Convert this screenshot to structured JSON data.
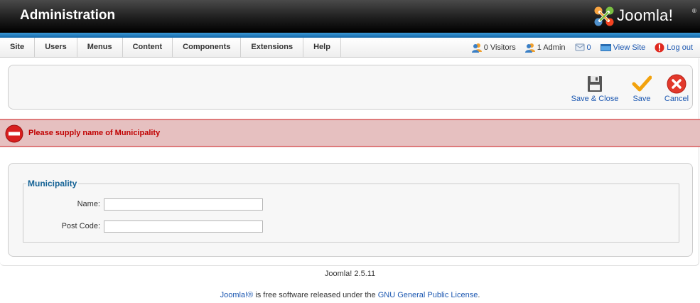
{
  "header": {
    "title": "Administration",
    "logo_text": "Joomla!",
    "logo_reg": "®"
  },
  "menu": {
    "items": [
      "Site",
      "Users",
      "Menus",
      "Content",
      "Components",
      "Extensions",
      "Help"
    ]
  },
  "status": {
    "visitors": "0 Visitors",
    "admins": "1 Admin",
    "messages": "0",
    "view_site": "View Site",
    "logout": "Log out"
  },
  "toolbar": {
    "save_close": "Save & Close",
    "save": "Save",
    "cancel": "Cancel"
  },
  "alert": {
    "message": "Please supply name of Municipality"
  },
  "form": {
    "legend": "Municipality",
    "name_label": "Name:",
    "name_value": "",
    "postcode_label": "Post Code:",
    "postcode_value": ""
  },
  "footer": {
    "version": "Joomla! 2.5.11",
    "license_link": "Joomla!®",
    "license_text": " is free software released under the ",
    "license_name": "GNU General Public License",
    "license_end": "."
  },
  "colors": {
    "accent_blue": "#1669a9",
    "link": "#1b57b1",
    "error_text": "#c00000",
    "error_bg": "#e6c0c0"
  }
}
